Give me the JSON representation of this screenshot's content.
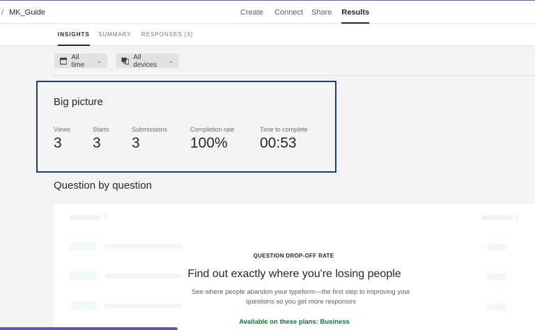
{
  "topnav": {
    "breadcrumb_sep": "/",
    "breadcrumb": "MK_Guide",
    "links": [
      "Create",
      "Connect",
      "Share",
      "Results"
    ],
    "active": "Results"
  },
  "subtabs": {
    "items": [
      "INSIGHTS",
      "SUMMARY",
      "RESPONSES [3]"
    ],
    "active": "INSIGHTS"
  },
  "filters": {
    "time": {
      "label": "All time",
      "icon": "calendar-icon"
    },
    "devices": {
      "label": "All devices",
      "icon": "devices-icon"
    }
  },
  "big_picture": {
    "title": "Big picture",
    "metrics": [
      {
        "label": "Views",
        "value": "3"
      },
      {
        "label": "Starts",
        "value": "3"
      },
      {
        "label": "Submissions",
        "value": "3"
      },
      {
        "label": "Completion rate",
        "value": "100%"
      },
      {
        "label": "Time to complete",
        "value": "00:53"
      }
    ]
  },
  "question_section": {
    "title": "Question by question"
  },
  "promo": {
    "eyebrow": "QUESTION DROP-OFF RATE",
    "heading": "Find out exactly where you're losing people",
    "description": "See where people abandon your typeform—the first step to improving your questions so you get more responses",
    "plans": "Available on these plans: Business"
  },
  "colors": {
    "highlight_border": "#173e7a",
    "plans_text": "#1b6e3a",
    "row_marker": "#e3f3ef",
    "dropoff_marker": "#fbe3e6"
  }
}
